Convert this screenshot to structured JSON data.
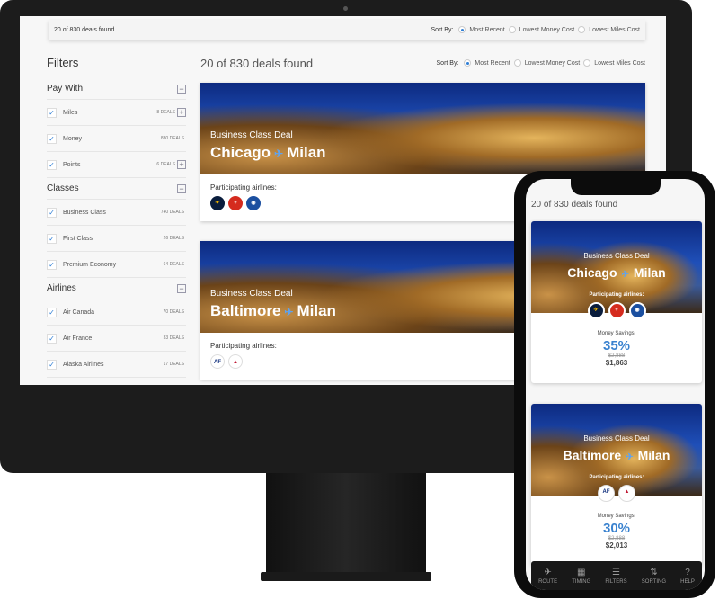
{
  "count_text": "20 of 830 deals found",
  "sort": {
    "label": "Sort By:",
    "options": [
      "Most Recent",
      "Lowest Money Cost",
      "Lowest Miles Cost"
    ],
    "selected": "Most Recent"
  },
  "filters": {
    "title": "Filters",
    "sections": [
      {
        "title": "Pay With",
        "items": [
          {
            "label": "Miles",
            "count": "8 DEALS",
            "expand": true
          },
          {
            "label": "Money",
            "count": "830 DEALS",
            "expand": false
          },
          {
            "label": "Points",
            "count": "6 DEALS",
            "expand": true
          }
        ]
      },
      {
        "title": "Classes",
        "items": [
          {
            "label": "Business Class",
            "count": "740 DEALS"
          },
          {
            "label": "First Class",
            "count": "26 DEALS"
          },
          {
            "label": "Premium Economy",
            "count": "64 DEALS"
          }
        ]
      },
      {
        "title": "Airlines",
        "items": [
          {
            "label": "Air Canada",
            "count": "70 DEALS"
          },
          {
            "label": "Air France",
            "count": "33 DEALS"
          },
          {
            "label": "Alaska Airlines",
            "count": "17 DEALS"
          }
        ]
      }
    ]
  },
  "deals": [
    {
      "class": "Business Class Deal",
      "from": "Chicago",
      "to": "Milan",
      "airlines_label": "Participating airlines:",
      "airlines": [
        "Lufthansa",
        "Swiss",
        "United"
      ],
      "savings_label": "Money Savings:",
      "savings": "35%",
      "old_price": "$2,888",
      "new_price": "$1,863"
    },
    {
      "class": "Business Class Deal",
      "from": "Baltimore",
      "to": "Milan",
      "airlines_label": "Participating airlines:",
      "airlines": [
        "AF",
        "DELTA"
      ],
      "savings_label": "Money Savings:",
      "savings": "30%",
      "old_price": "$2,888",
      "new_price": "$2,013"
    }
  ],
  "nav": [
    {
      "label": "ROUTE",
      "icon": "plane-icon"
    },
    {
      "label": "TIMING",
      "icon": "calendar-icon"
    },
    {
      "label": "FILTERS",
      "icon": "sliders-icon"
    },
    {
      "label": "SORTING",
      "icon": "sort-icon"
    },
    {
      "label": "HELP",
      "icon": "help-icon"
    }
  ],
  "colors": {
    "accent": "#2f7fd6",
    "savings": "#3a82cf"
  }
}
